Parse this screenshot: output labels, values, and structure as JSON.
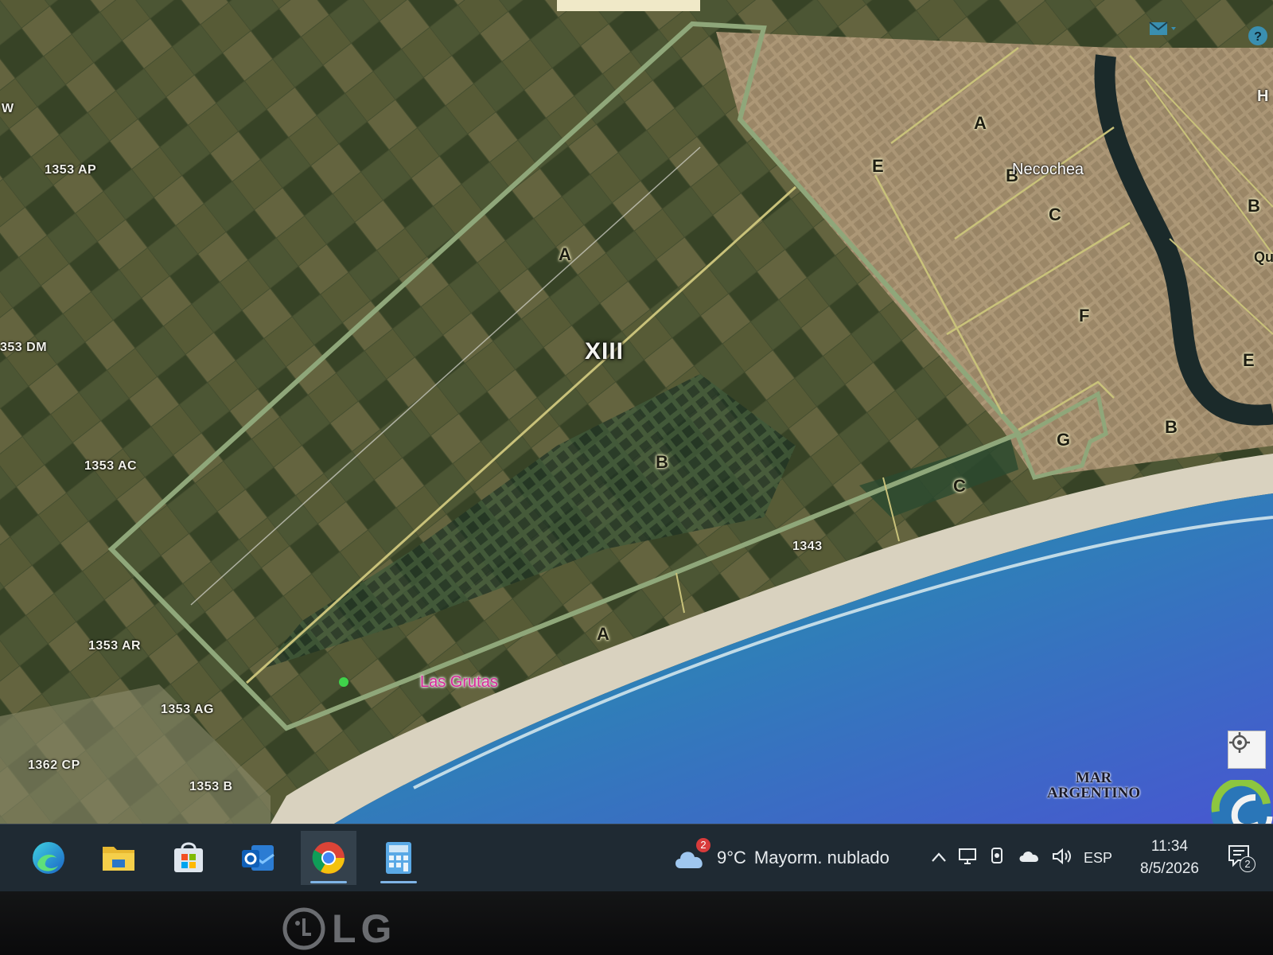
{
  "map": {
    "parcels": [
      "1353 AP",
      "353 DM",
      "1353 AC",
      "1353 AR",
      "1353 AG",
      "1362 CP",
      "1353 B",
      "1343",
      "W"
    ],
    "sections_left": [
      "A",
      "B",
      "C",
      "A"
    ],
    "sections_right": [
      "A",
      "B",
      "C",
      "E",
      "F",
      "G",
      "B",
      "E",
      "B"
    ],
    "circunscripcion": "XIII",
    "towns": {
      "necochea": "Necochea",
      "las_grutas": "Las Grutas"
    },
    "sea": {
      "line1": "MAR",
      "line2": "ARGENTINO"
    },
    "edge_fragments": {
      "right_top": "H",
      "right_mid": "Qu"
    },
    "colors": {
      "boundary": "#8fa77a",
      "section_line": "#c9c27a",
      "ocean": "#2a8fa6",
      "deep_ocean": "#3a4fc4"
    }
  },
  "controls": {
    "mail_icon": "envelope-icon",
    "help_icon": "help-circle-icon",
    "locate_icon": "crosshair-icon",
    "brand_logo": "globe-logo"
  },
  "taskbar": {
    "apps": [
      "edge",
      "file-explorer",
      "microsoft-store",
      "outlook",
      "chrome",
      "calculator"
    ],
    "active_app": "chrome",
    "weather": {
      "badge": "2",
      "temp": "9°C",
      "desc": "Mayorm. nublado"
    },
    "tray": {
      "language": "ESP"
    },
    "clock": {
      "time": "11:34",
      "date": "8/5/2026"
    },
    "notifications": {
      "count": "2"
    }
  },
  "monitor": {
    "brand": "LG"
  }
}
